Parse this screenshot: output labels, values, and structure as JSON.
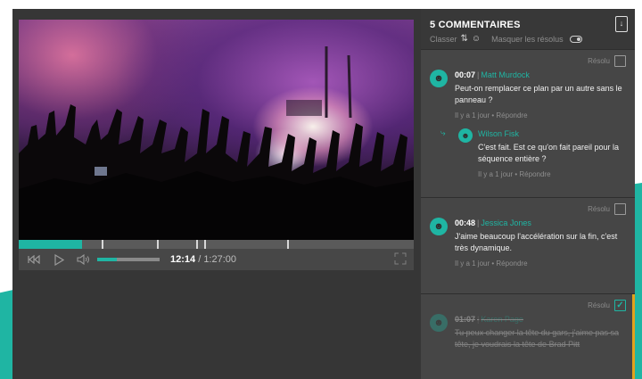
{
  "player": {
    "current_time": "12:14",
    "total_time": "/ 1:27:00",
    "progress_fraction": 0.16,
    "volume_fraction": 0.32,
    "markers_fraction": [
      0.21,
      0.35,
      0.45,
      0.47,
      0.68
    ],
    "icons": {
      "rewind": "rewind-icon",
      "play": "play-icon",
      "volume": "volume-icon",
      "fullscreen": "fullscreen-icon"
    },
    "accent_color": "#1fb5a3"
  },
  "comments_panel": {
    "title": "5 COMMENTAIRES",
    "sort_label": "Classer",
    "hide_resolved_label": "Masquer les résolus",
    "resolved_label": "Résolu",
    "threads": [
      {
        "resolved": false,
        "comment": {
          "timecode": "00:07",
          "author": "Matt Murdock",
          "text": "Peut-on remplacer ce plan par un autre sans le panneau ?",
          "age": "Il y a 1 jour",
          "reply_label": "Répondre"
        },
        "reply": {
          "author": "Wilson Fisk",
          "text": "C'est fait. Est ce qu'on fait pareil pour la séquence entière ?",
          "age": "Il y a 1 jour",
          "reply_label": "Répondre"
        }
      },
      {
        "resolved": false,
        "comment": {
          "timecode": "00:48",
          "author": "Jessica Jones",
          "text": "J'aime beaucoup l'accélération sur la fin, c'est très dynamique.",
          "age": "Il y a 1 jour",
          "reply_label": "Répondre"
        }
      },
      {
        "resolved": true,
        "comment": {
          "timecode": "01:07",
          "author": "Karen Page",
          "text": "Tu peux changer la tête du gars, j'aime pas sa tête, je voudrais la tête de Brad Pitt"
        }
      }
    ]
  }
}
